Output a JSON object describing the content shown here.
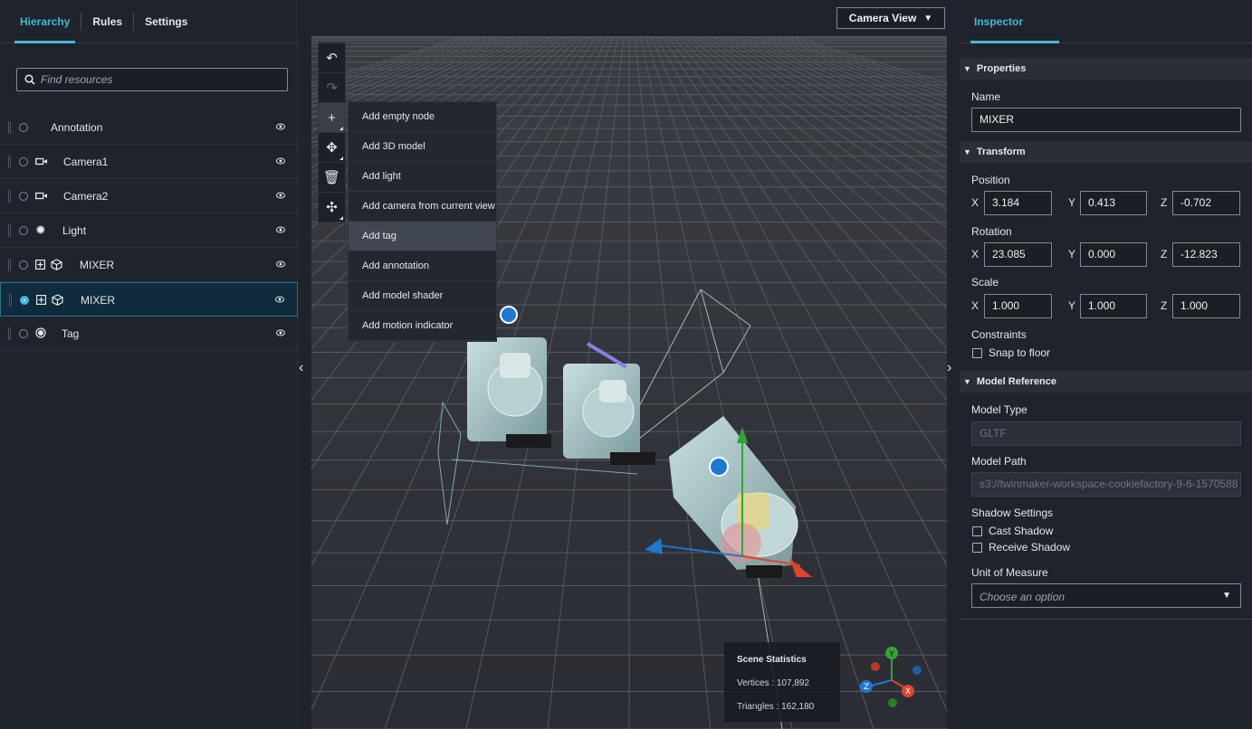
{
  "left_tabs": [
    "Hierarchy",
    "Rules",
    "Settings"
  ],
  "search": {
    "placeholder": "Find resources"
  },
  "tree": [
    {
      "label": "Annotation",
      "icon": "none",
      "selected": false
    },
    {
      "label": "Camera1",
      "icon": "camera-icon",
      "selected": false
    },
    {
      "label": "Camera2",
      "icon": "camera-icon",
      "selected": false
    },
    {
      "label": "Light",
      "icon": "light-icon",
      "selected": false
    },
    {
      "label": "MIXER",
      "icon": "model-icon",
      "selected": false
    },
    {
      "label": "MIXER",
      "icon": "model-icon",
      "selected": true
    },
    {
      "label": "Tag",
      "icon": "tag-icon",
      "selected": false
    }
  ],
  "camera_view": {
    "label": "Camera View"
  },
  "toolbar": {
    "items": [
      "undo-icon",
      "redo-icon",
      "add-icon",
      "transform-icon",
      "delete-icon",
      "move-icon"
    ]
  },
  "add_menu": [
    "Add empty node",
    "Add 3D model",
    "Add light",
    "Add camera from current view",
    "Add tag",
    "Add annotation",
    "Add model shader",
    "Add motion indicator"
  ],
  "scene_stats": {
    "title": "Scene Statistics",
    "vertices": "Vertices : 107,892",
    "triangles": "Triangles : 162,180"
  },
  "inspector": {
    "tab": "Inspector",
    "properties_title": "Properties",
    "name_label": "Name",
    "name_value": "MIXER",
    "transform_title": "Transform",
    "position_label": "Position",
    "position": {
      "x": "3.184",
      "y": "0.413",
      "z": "-0.702"
    },
    "rotation_label": "Rotation",
    "rotation": {
      "x": "23.085",
      "y": "0.000",
      "z": "-12.823"
    },
    "scale_label": "Scale",
    "scale": {
      "x": "1.000",
      "y": "1.000",
      "z": "1.000"
    },
    "constraints_label": "Constraints",
    "snap_label": "Snap to floor",
    "model_ref_title": "Model Reference",
    "model_type_label": "Model Type",
    "model_type_value": "GLTF",
    "model_path_label": "Model Path",
    "model_path_value": "s3://twinmaker-workspace-cookiefactory-9-6-1570588",
    "shadow_label": "Shadow Settings",
    "cast_shadow": "Cast Shadow",
    "receive_shadow": "Receive Shadow",
    "unit_label": "Unit of Measure",
    "unit_placeholder": "Choose an option"
  },
  "axis_letters": {
    "x": "X",
    "y": "Y",
    "z": "Z"
  },
  "colors": {
    "accent": "#44b9d6",
    "x_axis": "#e0442f",
    "y_axis": "#34a33a",
    "z_axis": "#1f78d1"
  }
}
